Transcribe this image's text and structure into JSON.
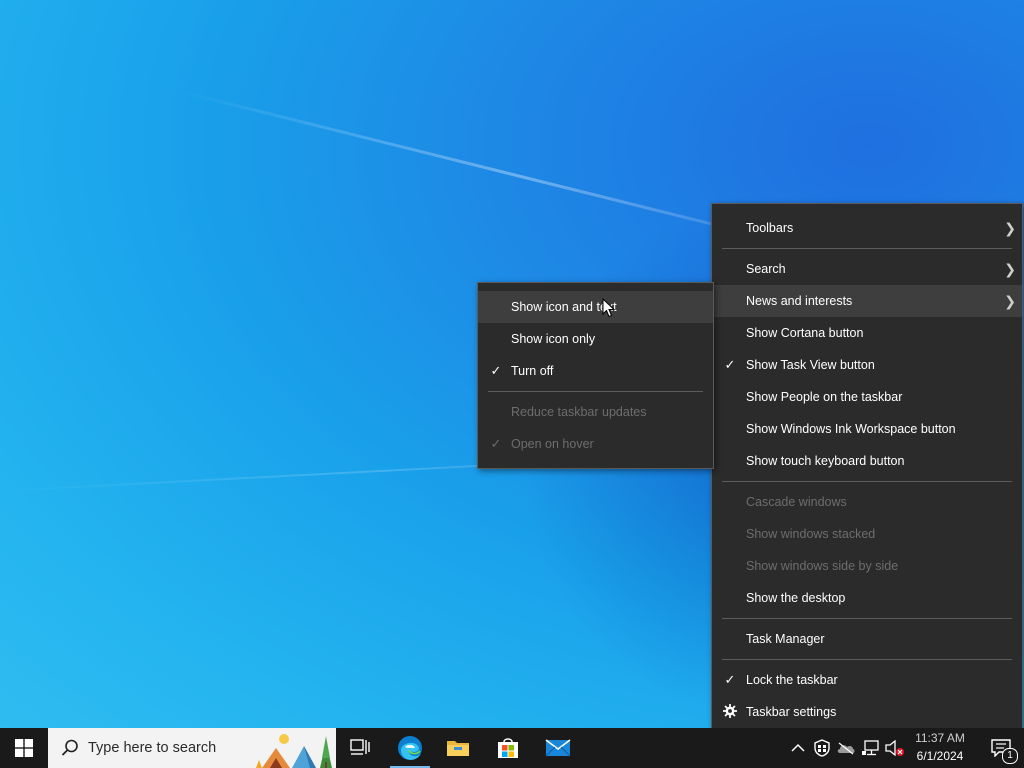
{
  "taskbar_menu": {
    "items": [
      {
        "label": "Toolbars",
        "submenu": true
      },
      {
        "label": "Search",
        "submenu": true
      },
      {
        "label": "News and interests",
        "submenu": true
      },
      {
        "label": "Show Cortana button"
      },
      {
        "label": "Show Task View button",
        "checked": true
      },
      {
        "label": "Show People on the taskbar"
      },
      {
        "label": "Show Windows Ink Workspace button"
      },
      {
        "label": "Show touch keyboard button"
      },
      {
        "label": "Cascade windows",
        "disabled": true
      },
      {
        "label": "Show windows stacked",
        "disabled": true
      },
      {
        "label": "Show windows side by side",
        "disabled": true
      },
      {
        "label": "Show the desktop"
      },
      {
        "label": "Task Manager"
      },
      {
        "label": "Lock the taskbar",
        "checked": true
      },
      {
        "label": "Taskbar settings",
        "icon": "gear-icon"
      }
    ]
  },
  "news_submenu": {
    "items": [
      {
        "label": "Show icon and text",
        "hover": true
      },
      {
        "label": "Show icon only"
      },
      {
        "label": "Turn off",
        "checked": true
      },
      {
        "label": "Reduce taskbar updates",
        "disabled": true
      },
      {
        "label": "Open on hover",
        "checked": true,
        "disabled": true
      }
    ]
  },
  "taskbar": {
    "search_placeholder": "Type here to search",
    "clock_time": "11:37 AM",
    "clock_date": "6/1/2024",
    "notification_count": "1",
    "pinned": [
      "task-view-icon",
      "edge-icon",
      "file-explorer-icon",
      "store-icon",
      "mail-icon"
    ],
    "tray": [
      "chevron-up-icon",
      "security-icon",
      "onedrive-icon",
      "network-icon",
      "volume-muted-icon"
    ]
  },
  "colors": {
    "menu_bg": "#2b2b2b",
    "menu_hover": "#3e3e3e",
    "menu_disabled_text": "#6d6d6d",
    "taskbar_bg": "#1a1a1a",
    "accent": "#76b9ed"
  }
}
